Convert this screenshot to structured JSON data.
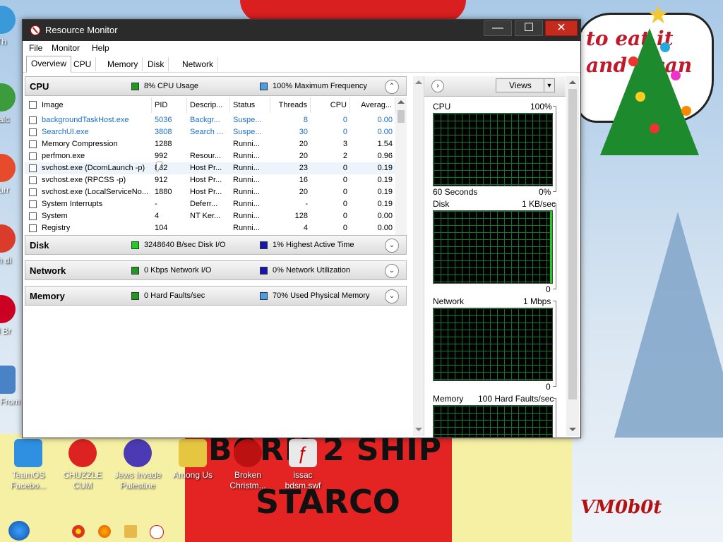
{
  "desktop": {
    "wallpaper_texts": {
      "born": "BORN 2 SHIP",
      "starco": "STARCO",
      "signature": "VM0b0t",
      "speech": "to eat it and c can"
    },
    "icons": [
      {
        "label": "TeamOS Facebo...",
        "color": "#2f8fe0"
      },
      {
        "label": "CHUZZLE CUM",
        "color": "#d22"
      },
      {
        "label": "Jews Invade Palestine",
        "color": "#4b3ab3"
      },
      {
        "label": "Among Us",
        "color": "#e6c640"
      },
      {
        "label": "Broken Christm...",
        "color": "#b11"
      },
      {
        "label": "issac bdsm.swf",
        "color": "#e9e9e9"
      }
    ],
    "left_partial_labels": [
      "Th",
      "Falc",
      "Furr",
      "Ch di",
      "Ol Br",
      "Dov From"
    ]
  },
  "window": {
    "title": "Resource Monitor",
    "controls": {
      "minimize": "—",
      "maximize": "☐",
      "close": "✕"
    },
    "menu": [
      "File",
      "Monitor",
      "Help"
    ],
    "tabs": [
      "Overview",
      "CPU",
      "Memory",
      "Disk",
      "Network"
    ],
    "active_tab": "Overview",
    "cpu": {
      "title": "CPU",
      "usage": "8% CPU Usage",
      "freq": "100% Maximum Frequency",
      "usage_color": "#1e9b1e",
      "freq_color": "#4a9ee8",
      "columns": [
        "Image",
        "PID",
        "Descrip...",
        "Status",
        "Threads",
        "CPU",
        "Averag..."
      ],
      "rows": [
        {
          "image": "backgroundTaskHost.exe",
          "pid": "5036",
          "desc": "Backgr...",
          "status": "Suspe...",
          "threads": "8",
          "cpu": "0",
          "avg": "0.00",
          "blue": true
        },
        {
          "image": "SearchUI.exe",
          "pid": "3808",
          "desc": "Search ...",
          "status": "Suspe...",
          "threads": "30",
          "cpu": "0",
          "avg": "0.00",
          "blue": true
        },
        {
          "image": "Memory Compression",
          "pid": "1288",
          "desc": "",
          "status": "Runni...",
          "threads": "20",
          "cpu": "3",
          "avg": "1.54",
          "blue": false
        },
        {
          "image": "perfmon.exe",
          "pid": "992",
          "desc": "Resour...",
          "status": "Runni...",
          "threads": "20",
          "cpu": "2",
          "avg": "0.96",
          "blue": false
        },
        {
          "image": "svchost.exe (DcomLaunch -p)",
          "pid": "832",
          "desc": "Host Pr...",
          "status": "Runni...",
          "threads": "23",
          "cpu": "0",
          "avg": "0.19",
          "blue": false
        },
        {
          "image": "svchost.exe (RPCSS -p)",
          "pid": "912",
          "desc": "Host Pr...",
          "status": "Runni...",
          "threads": "16",
          "cpu": "0",
          "avg": "0.19",
          "blue": false
        },
        {
          "image": "svchost.exe (LocalServiceNo...",
          "pid": "1880",
          "desc": "Host Pr...",
          "status": "Runni...",
          "threads": "20",
          "cpu": "0",
          "avg": "0.19",
          "blue": false
        },
        {
          "image": "System Interrupts",
          "pid": "-",
          "desc": "Deferr...",
          "status": "Runni...",
          "threads": "-",
          "cpu": "0",
          "avg": "0.19",
          "blue": false
        },
        {
          "image": "System",
          "pid": "4",
          "desc": "NT Ker...",
          "status": "Runni...",
          "threads": "128",
          "cpu": "0",
          "avg": "0.00",
          "blue": false
        },
        {
          "image": "Registry",
          "pid": "104",
          "desc": "",
          "status": "Runni...",
          "threads": "4",
          "cpu": "0",
          "avg": "0.00",
          "blue": false
        }
      ]
    },
    "disk": {
      "title": "Disk",
      "stat1": "3248640 B/sec Disk I/O",
      "stat2": "1% Highest Active Time",
      "color1": "#1ed01e",
      "color2": "#1616b0"
    },
    "network": {
      "title": "Network",
      "stat1": "0 Kbps Network I/O",
      "stat2": "0% Network Utilization",
      "color1": "#1e9b1e",
      "color2": "#1616b0"
    },
    "memory": {
      "title": "Memory",
      "stat1": "0 Hard Faults/sec",
      "stat2": "70% Used Physical Memory",
      "color1": "#1e9b1e",
      "color2": "#4a9ee8"
    },
    "right": {
      "views_label": "Views",
      "graphs": [
        {
          "name": "CPU",
          "max": "100%",
          "bottom_left": "60 Seconds",
          "bottom_right": "0%"
        },
        {
          "name": "Disk",
          "max": "1 KB/sec",
          "bottom_left": "",
          "bottom_right": "0"
        },
        {
          "name": "Network",
          "max": "1 Mbps",
          "bottom_left": "",
          "bottom_right": "0"
        },
        {
          "name": "Memory",
          "max": "100 Hard Faults/sec",
          "bottom_left": "",
          "bottom_right": ""
        }
      ]
    }
  }
}
